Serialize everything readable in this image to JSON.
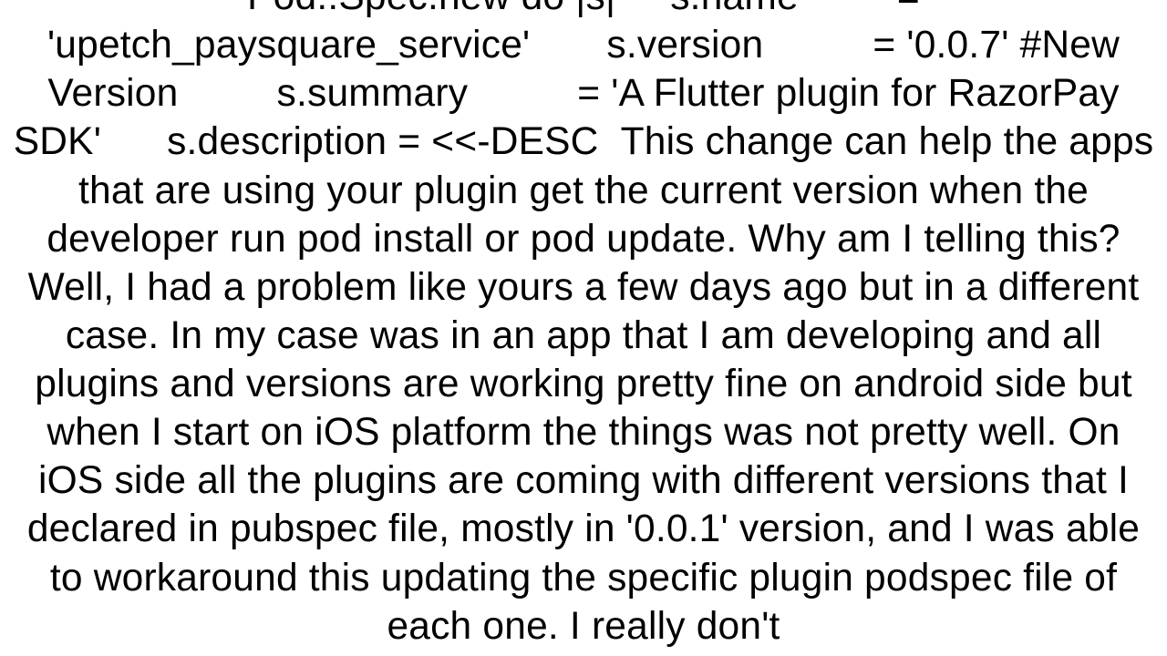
{
  "document": {
    "content": "Pod::Spec.new do |s|     s.name         = 'upetch_paysquare_service'       s.version          = '0.0.7' #New Version         s.summary          = 'A Flutter plugin for RazorPay SDK'      s.description = <<-DESC  This change can help the apps that are using your plugin get the current version when the developer run pod install or pod update. Why am I telling this? Well, I had a problem like yours a few days ago but in a different case. In my case was in an app that I am developing and all plugins and versions are working pretty fine on android side but when I start on iOS platform the things was not pretty well. On iOS side all the plugins are coming with different versions that I declared in pubspec file, mostly in '0.0.1' version, and I was able to workaround this updating the specific plugin podspec file of each one. I really don't"
  }
}
